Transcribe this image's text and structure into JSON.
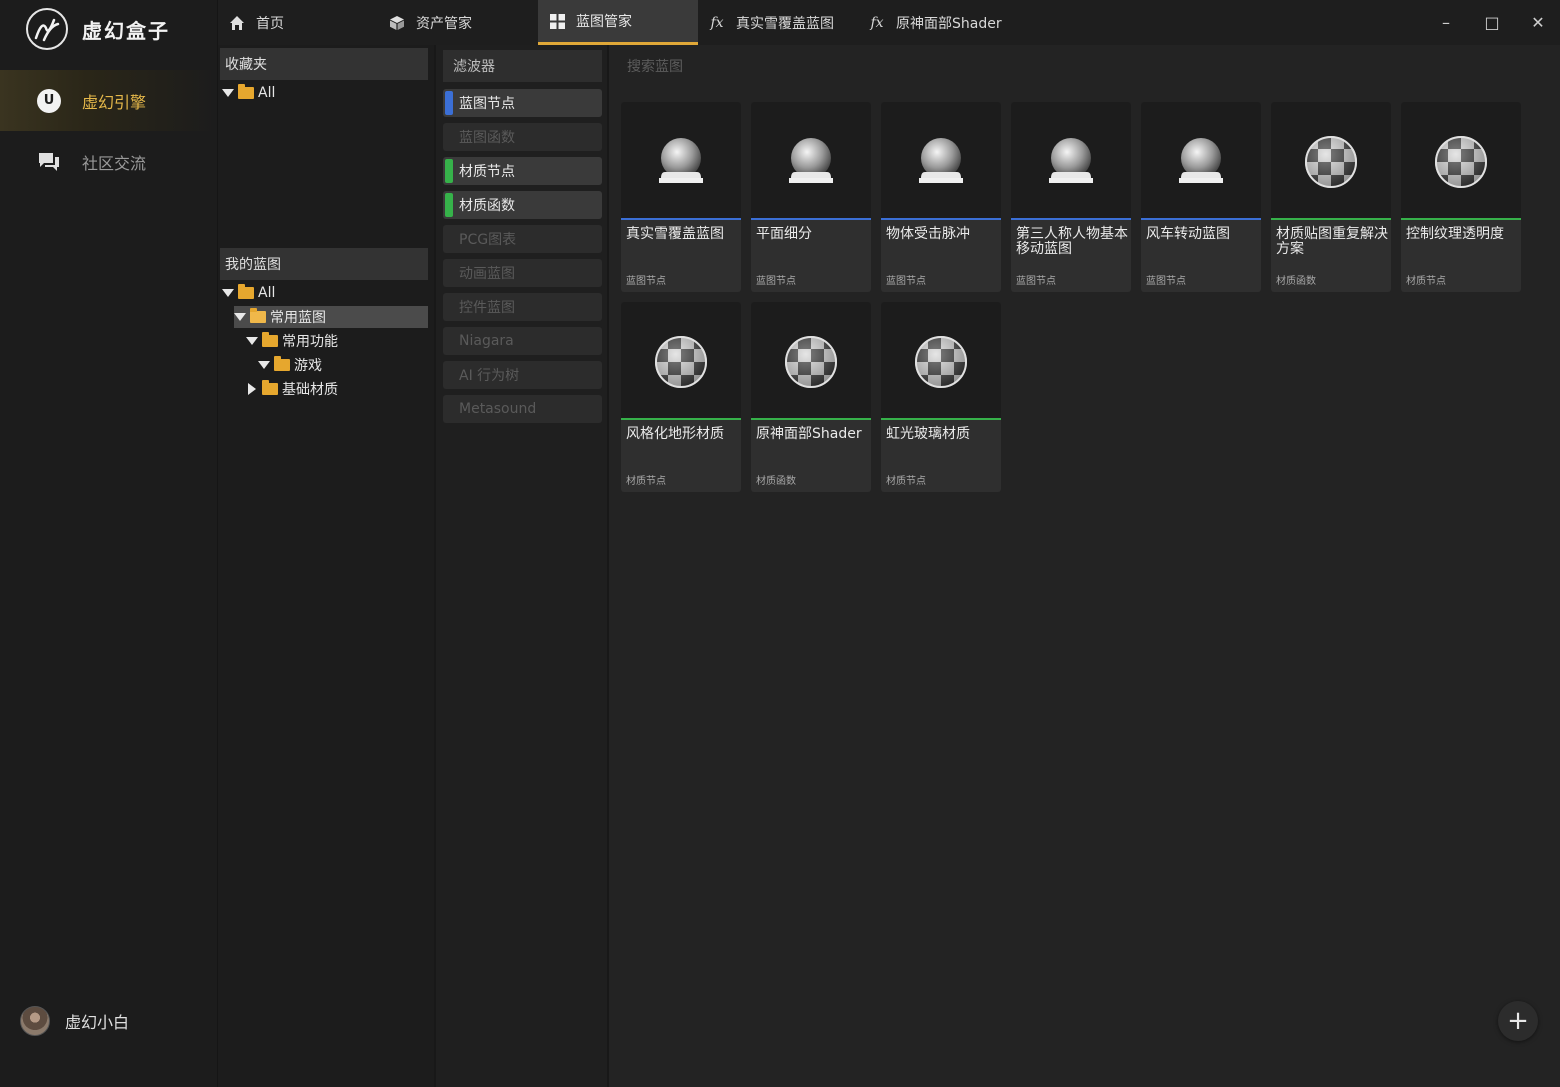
{
  "app": {
    "name": "虚幻盒子"
  },
  "sidebar": {
    "items": [
      {
        "label": "虚幻引擎",
        "icon": "unreal-engine-icon",
        "active": true
      },
      {
        "label": "社区交流",
        "icon": "chat-icon",
        "active": false
      }
    ],
    "user": {
      "name": "虚幻小白"
    }
  },
  "tabs": [
    {
      "label": "首页",
      "icon": "home-icon"
    },
    {
      "label": "资产管家",
      "icon": "cube-icon"
    },
    {
      "label": "蓝图管家",
      "icon": "grid-icon",
      "active": true
    },
    {
      "label": "真实雪覆盖蓝图",
      "icon": "function-icon",
      "icon_text": "fx"
    },
    {
      "label": "原神面部Shader",
      "icon": "function-icon",
      "icon_text": "fx"
    }
  ],
  "window": {
    "minimize": "–",
    "maximize": "□",
    "close": "✕"
  },
  "favorites": {
    "header": "收藏夹",
    "tree": [
      {
        "label": "All"
      }
    ]
  },
  "my_blueprints": {
    "header": "我的蓝图",
    "tree": [
      {
        "label": "All"
      },
      {
        "label": "常用蓝图"
      },
      {
        "label": "常用功能"
      },
      {
        "label": "游戏"
      },
      {
        "label": "基础材质"
      }
    ]
  },
  "filter": {
    "header": "滤波器",
    "items": [
      {
        "label": "蓝图节点",
        "enabled": true,
        "color": "#3b6fd6"
      },
      {
        "label": "蓝图函数",
        "enabled": false
      },
      {
        "label": "材质节点",
        "enabled": true,
        "color": "#36b24a"
      },
      {
        "label": "材质函数",
        "enabled": true,
        "color": "#36b24a"
      },
      {
        "label": "PCG图表",
        "enabled": false
      },
      {
        "label": "动画蓝图",
        "enabled": false
      },
      {
        "label": "控件蓝图",
        "enabled": false
      },
      {
        "label": "Niagara",
        "enabled": false
      },
      {
        "label": "AI 行为树",
        "enabled": false
      },
      {
        "label": "Metasound",
        "enabled": false
      }
    ]
  },
  "search": {
    "placeholder": "搜索蓝图"
  },
  "cards": [
    {
      "title": "真实雪覆盖蓝图",
      "type": "蓝图节点",
      "kind": "blueprint"
    },
    {
      "title": "平面细分",
      "type": "蓝图节点",
      "kind": "blueprint"
    },
    {
      "title": "物体受击脉冲",
      "type": "蓝图节点",
      "kind": "blueprint"
    },
    {
      "title": "第三人称人物基本移动蓝图",
      "type": "蓝图节点",
      "kind": "blueprint"
    },
    {
      "title": "风车转动蓝图",
      "type": "蓝图节点",
      "kind": "blueprint"
    },
    {
      "title": "材质贴图重复解决方案",
      "type": "材质函数",
      "kind": "material"
    },
    {
      "title": "控制纹理透明度",
      "type": "材质节点",
      "kind": "material"
    },
    {
      "title": "风格化地形材质",
      "type": "材质节点",
      "kind": "material"
    },
    {
      "title": "原神面部Shader",
      "type": "材质函数",
      "kind": "material"
    },
    {
      "title": "虹光玻璃材质",
      "type": "材质节点",
      "kind": "material"
    }
  ],
  "fab": {
    "label": "+"
  }
}
